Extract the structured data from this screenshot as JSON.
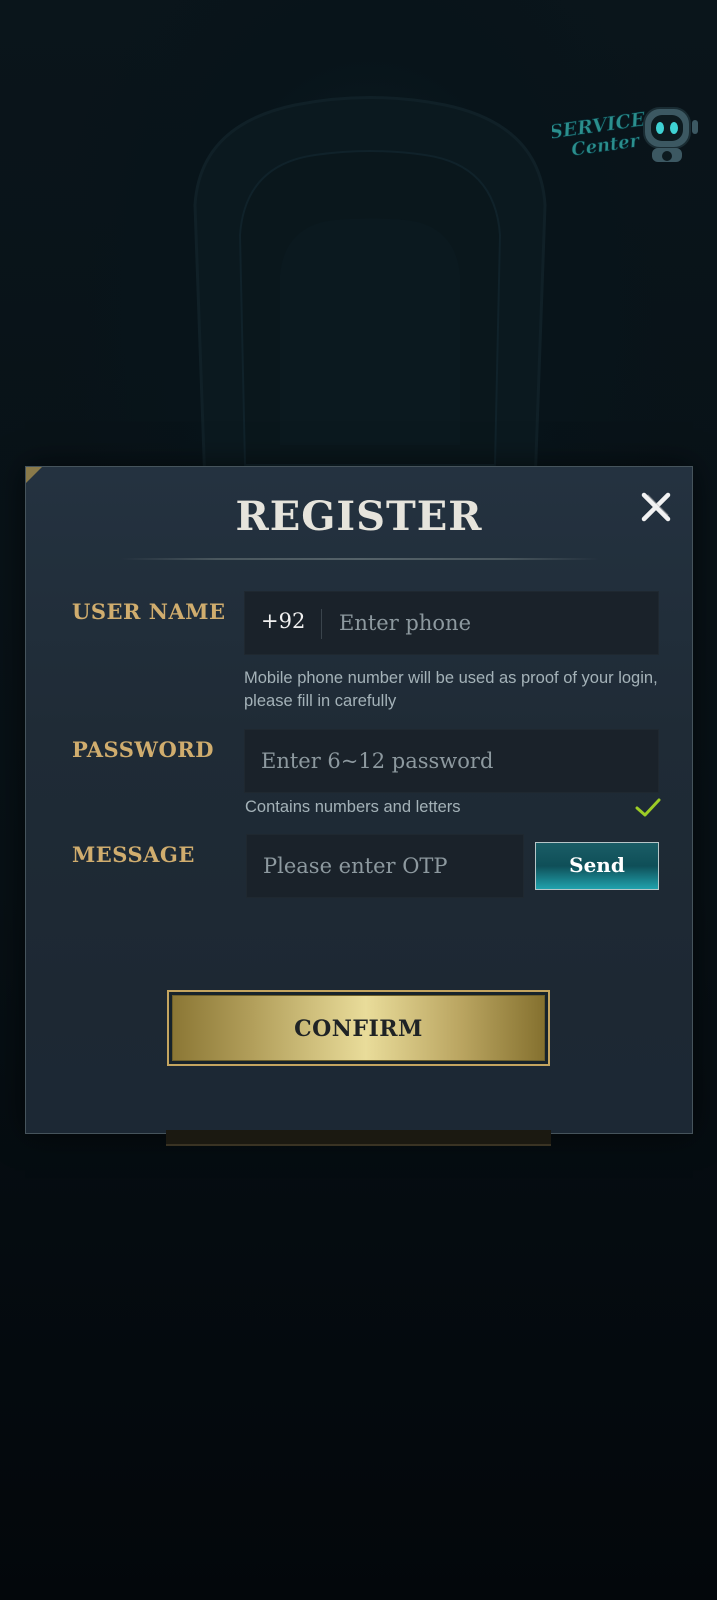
{
  "badge": {
    "line1": "SERVICE",
    "line2": "Center"
  },
  "dialog": {
    "title": "REGISTER",
    "close_icon": "close-icon"
  },
  "fields": {
    "username": {
      "label": "USER NAME",
      "prefix": "+92",
      "placeholder": "Enter phone",
      "value": "",
      "hint": "Mobile phone number will be used as proof of your login, please fill in carefully"
    },
    "password": {
      "label": "PASSWORD",
      "placeholder": "Enter 6~12 password",
      "value": "",
      "hint": "Contains numbers and letters",
      "hint_icon": "check-icon",
      "hint_icon_color": "#9ccc26"
    },
    "message": {
      "label": "MESSAGE",
      "placeholder": "Please enter OTP",
      "value": "",
      "send_label": "Send"
    }
  },
  "actions": {
    "confirm_label": "CONFIRM"
  },
  "colors": {
    "label_gold": "#d0ad6e",
    "send_teal": "#1a7e88",
    "confirm_gold": "#e9dc9a"
  }
}
